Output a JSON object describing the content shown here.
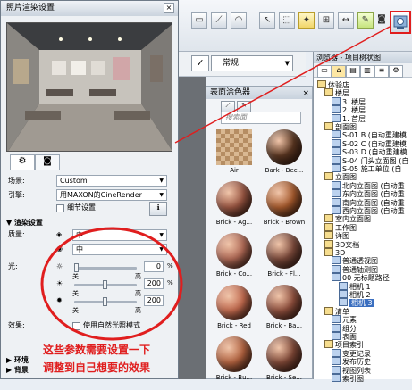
{
  "dialog": {
    "title": "照片渲染设置",
    "close": "×",
    "tab_settings_icon": "gear-icon",
    "tab_camera_icon": "camera-icon",
    "scene_label": "场景:",
    "scene_value": "Custom",
    "engine_label": "引擎:",
    "engine_value": "用MAXON的CineRender",
    "detail_label": "细节设置",
    "section_render": "渲染设置",
    "quality_label": "质量:",
    "quality_value_1": "中",
    "quality_value_2": "中",
    "light_label": "光:",
    "slider1": {
      "left": "关",
      "right": "高",
      "value": "0",
      "unit": "%"
    },
    "slider2": {
      "left": "关",
      "right": "高",
      "value": "200",
      "unit": "%"
    },
    "slider3": {
      "left": "关",
      "right": "高",
      "value": "200",
      "unit": ""
    },
    "effect_label": "效果:",
    "effect_check": "使用自然光照模式",
    "section_env": "环境",
    "section_bg": "背景"
  },
  "toolbar2": {
    "combo_value": "常规"
  },
  "material_panel": {
    "title": "表面涂色器",
    "search_placeholder": "搜索面",
    "items": [
      {
        "label": "Air",
        "color": "#c8a27a"
      },
      {
        "label": "Bark - Bec...",
        "color": "#5a3621"
      },
      {
        "label": "Brick - Ag...",
        "color": "#9a5642"
      },
      {
        "label": "Brick - Brown",
        "color": "#a65a2d"
      },
      {
        "label": "Brick - Co...",
        "color": "#b16a56"
      },
      {
        "label": "Brick - Fl...",
        "color": "#7c4a3b"
      },
      {
        "label": "Brick - Red",
        "color": "#c26a4e"
      },
      {
        "label": "Brick - Ba...",
        "color": "#8f4f3d"
      },
      {
        "label": "Brick - Bu...",
        "color": "#b2623f"
      },
      {
        "label": "Brick - Se...",
        "color": "#7e4736"
      }
    ]
  },
  "navigator": {
    "title": "浏览器 - 项目树状图",
    "tree": [
      {
        "label": "体验店",
        "indent": 0
      },
      {
        "label": "楼层",
        "indent": 1
      },
      {
        "label": "3. 楼层",
        "indent": 2
      },
      {
        "label": "2. 楼层",
        "indent": 2
      },
      {
        "label": "1. 首层",
        "indent": 2
      },
      {
        "label": "剖面图",
        "indent": 1
      },
      {
        "label": "S-01 B (自动重建模",
        "indent": 2
      },
      {
        "label": "S-02 C (自动重建模",
        "indent": 2
      },
      {
        "label": "S-03 D (自动重建模",
        "indent": 2
      },
      {
        "label": "S-04 门头立面图 (自",
        "indent": 2
      },
      {
        "label": "S-05 施工单位 (自",
        "indent": 2
      },
      {
        "label": "立面图",
        "indent": 1
      },
      {
        "label": "北向立面图 (自动重",
        "indent": 2
      },
      {
        "label": "东向立面图 (自动重",
        "indent": 2
      },
      {
        "label": "南向立面图 (自动重",
        "indent": 2
      },
      {
        "label": "西向立面图 (自动重",
        "indent": 2
      },
      {
        "label": "室内立面图",
        "indent": 1
      },
      {
        "label": "工作图",
        "indent": 1
      },
      {
        "label": "详图",
        "indent": 1
      },
      {
        "label": "3D文档",
        "indent": 1
      },
      {
        "label": "3D",
        "indent": 1
      },
      {
        "label": "普通透视图",
        "indent": 2
      },
      {
        "label": "普通轴测图",
        "indent": 2
      },
      {
        "label": "00 无标题路径",
        "indent": 2
      },
      {
        "label": "相机 1",
        "indent": 3
      },
      {
        "label": "相机 2",
        "indent": 3
      },
      {
        "label": "相机 3",
        "indent": 3,
        "selected": true
      },
      {
        "label": "清单",
        "indent": 1
      },
      {
        "label": "元素",
        "indent": 2
      },
      {
        "label": "组分",
        "indent": 2
      },
      {
        "label": "表面",
        "indent": 2
      },
      {
        "label": "项目索引",
        "indent": 1
      },
      {
        "label": "变更记录",
        "indent": 2
      },
      {
        "label": "发布历史",
        "indent": 2
      },
      {
        "label": "视图列表",
        "indent": 2
      },
      {
        "label": "索引图",
        "indent": 2
      }
    ]
  },
  "annotation": {
    "line1": "这些参数需要设置一下",
    "line2": "调整到自己想要的效果",
    "color": "#e01e1e"
  }
}
